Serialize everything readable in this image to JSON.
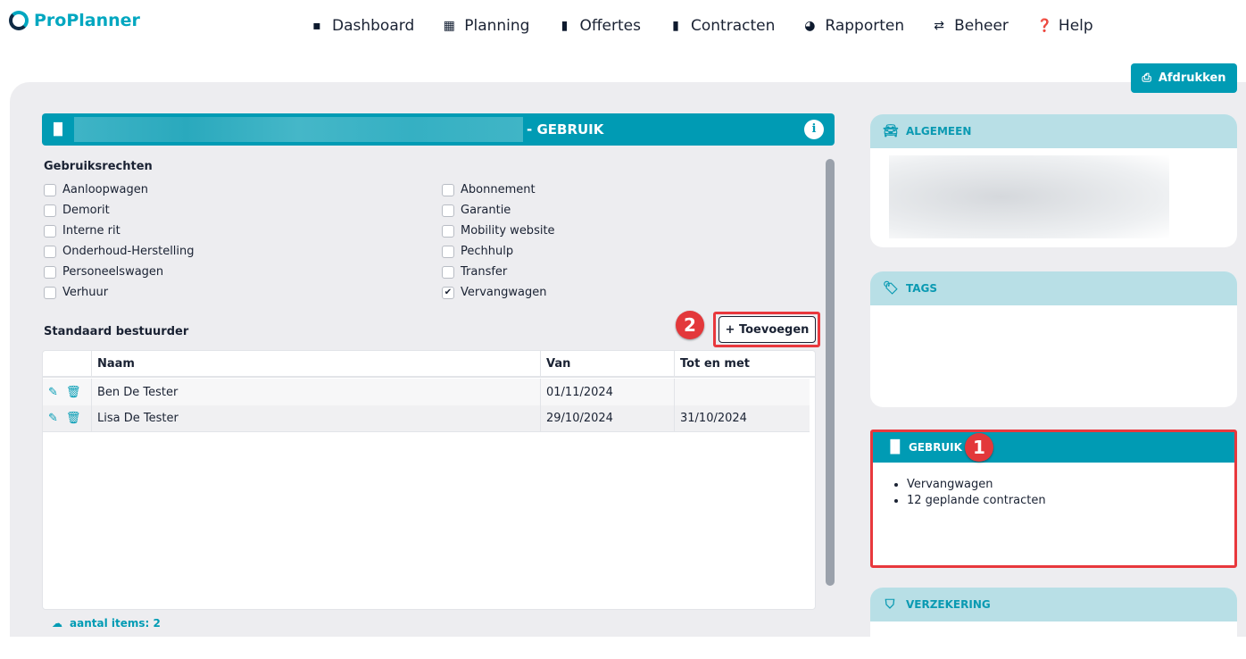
{
  "app": {
    "name": "ProPlanner"
  },
  "nav": [
    {
      "label": "Dashboard",
      "icon": "grid-icon"
    },
    {
      "label": "Planning",
      "icon": "calendar-icon"
    },
    {
      "label": "Offertes",
      "icon": "file-icon"
    },
    {
      "label": "Contracten",
      "icon": "contract-icon"
    },
    {
      "label": "Rapporten",
      "icon": "pie-chart-icon"
    },
    {
      "label": "Beheer",
      "icon": "settings-icon"
    },
    {
      "label": "Help",
      "icon": "help-icon"
    }
  ],
  "print_label": "Afdrukken",
  "panel": {
    "title": "- GEBRUIK",
    "info": "i",
    "rights_label": "Gebruiksrechten",
    "rights": [
      {
        "label": "Aanloopwagen",
        "checked": false
      },
      {
        "label": "Abonnement",
        "checked": false
      },
      {
        "label": "Demorit",
        "checked": false
      },
      {
        "label": "Garantie",
        "checked": false
      },
      {
        "label": "Interne rit",
        "checked": false
      },
      {
        "label": "Mobility website",
        "checked": false
      },
      {
        "label": "Onderhoud-Herstelling",
        "checked": false
      },
      {
        "label": "Pechhulp",
        "checked": false
      },
      {
        "label": "Personeelswagen",
        "checked": false
      },
      {
        "label": "Transfer",
        "checked": false
      },
      {
        "label": "Verhuur",
        "checked": false
      },
      {
        "label": "Vervangwagen",
        "checked": true
      }
    ],
    "driver_label": "Standaard bestuurder",
    "add_label": "+ Toevoegen",
    "columns": [
      "Naam",
      "Van",
      "Tot en met"
    ],
    "rows": [
      [
        "Ben De Tester",
        "01/11/2024",
        ""
      ],
      [
        "Lisa De Tester",
        "29/10/2024",
        "31/10/2024"
      ]
    ],
    "count": "aantal items: 2"
  },
  "annotations": [
    "1",
    "2"
  ],
  "cards": {
    "algemeen": "ALGEMEEN",
    "tags": "TAGS",
    "gebruik": "GEBRUIK",
    "verzekering": "VERZEKERING",
    "gebruik_items": [
      "Vervangwagen",
      "12 geplande contracten"
    ]
  },
  "colors": {
    "accent": "#009bb4",
    "light": "#b8dfe6",
    "annotation": "#e3383b"
  }
}
